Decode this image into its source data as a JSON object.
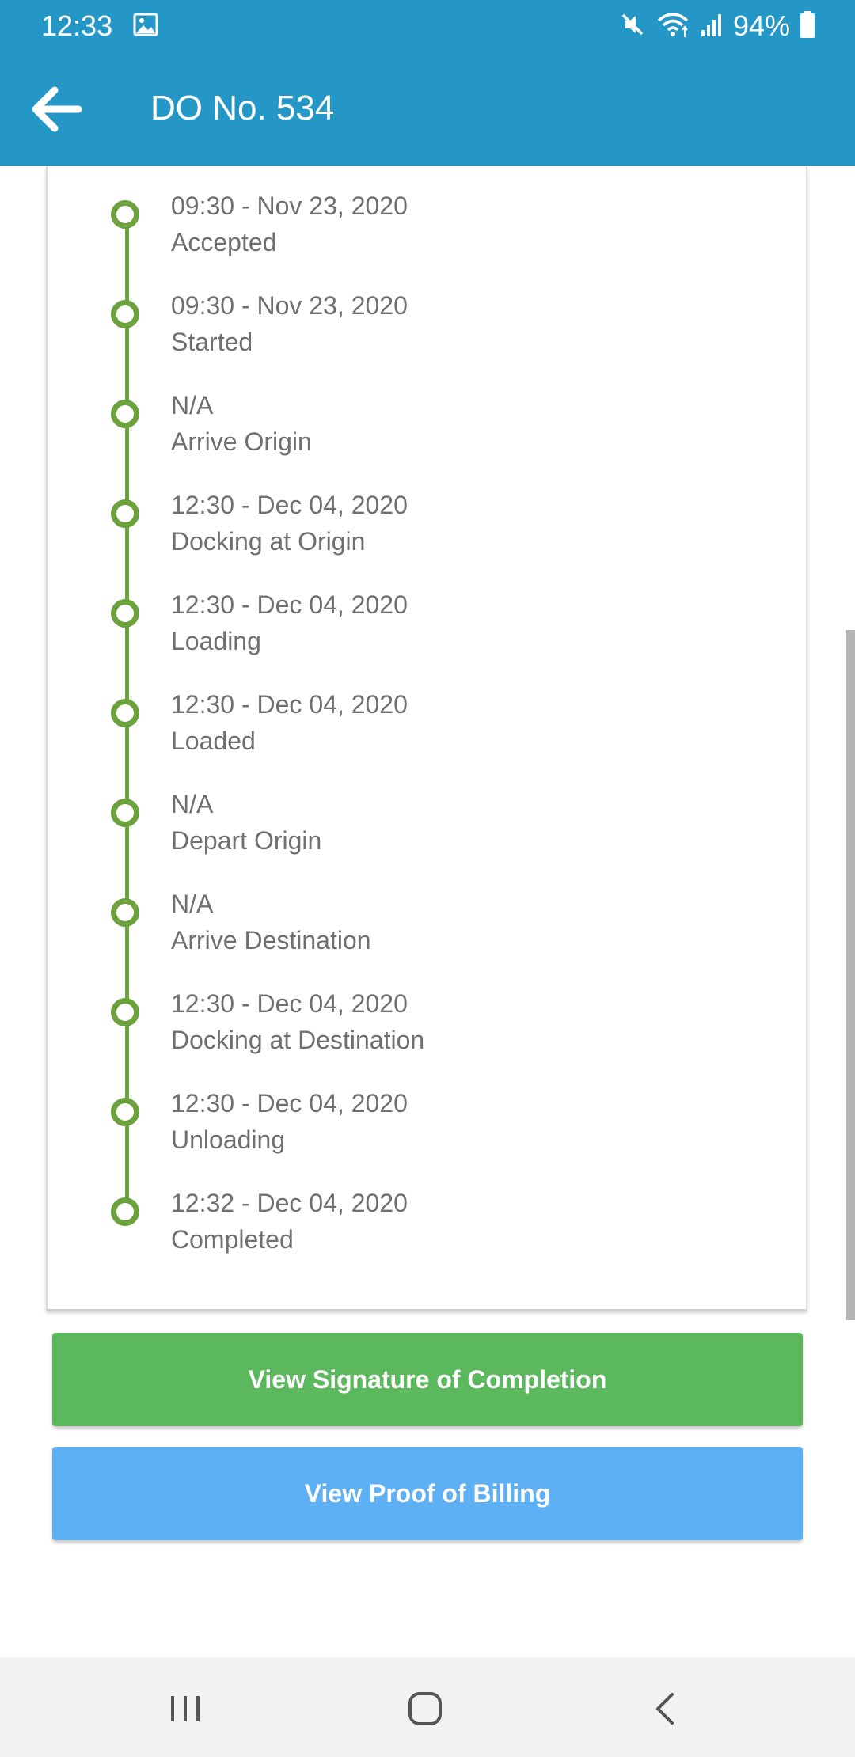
{
  "status_bar": {
    "time": "12:33",
    "battery": "94%",
    "icons": [
      "image-icon",
      "mute-icon",
      "wifi-icon",
      "signal-icon",
      "battery-icon"
    ]
  },
  "header": {
    "title": "DO No. 534",
    "back_icon": "arrow-left-icon"
  },
  "timeline": [
    {
      "time": "09:30 - Nov 23, 2020",
      "status": "Accepted"
    },
    {
      "time": "09:30 - Nov 23, 2020",
      "status": "Started"
    },
    {
      "time": "N/A",
      "status": "Arrive Origin"
    },
    {
      "time": "12:30 - Dec 04, 2020",
      "status": "Docking at Origin"
    },
    {
      "time": "12:30 - Dec 04, 2020",
      "status": "Loading"
    },
    {
      "time": "12:30 - Dec 04, 2020",
      "status": "Loaded"
    },
    {
      "time": "N/A",
      "status": "Depart Origin"
    },
    {
      "time": "N/A",
      "status": "Arrive Destination"
    },
    {
      "time": "12:30 - Dec 04, 2020",
      "status": "Docking at Destination"
    },
    {
      "time": "12:30 - Dec 04, 2020",
      "status": "Unloading"
    },
    {
      "time": "12:32 - Dec 04, 2020",
      "status": "Completed"
    }
  ],
  "actions": {
    "signature_label": "View Signature of Completion",
    "billing_label": "View Proof of Billing"
  },
  "colors": {
    "header": "#2597c6",
    "timeline": "#6ca23c",
    "signature_button": "#5cb85c",
    "billing_button": "#5eb0f4"
  },
  "nav_bar": {
    "icons": [
      "recents-icon",
      "home-icon",
      "back-icon"
    ]
  }
}
